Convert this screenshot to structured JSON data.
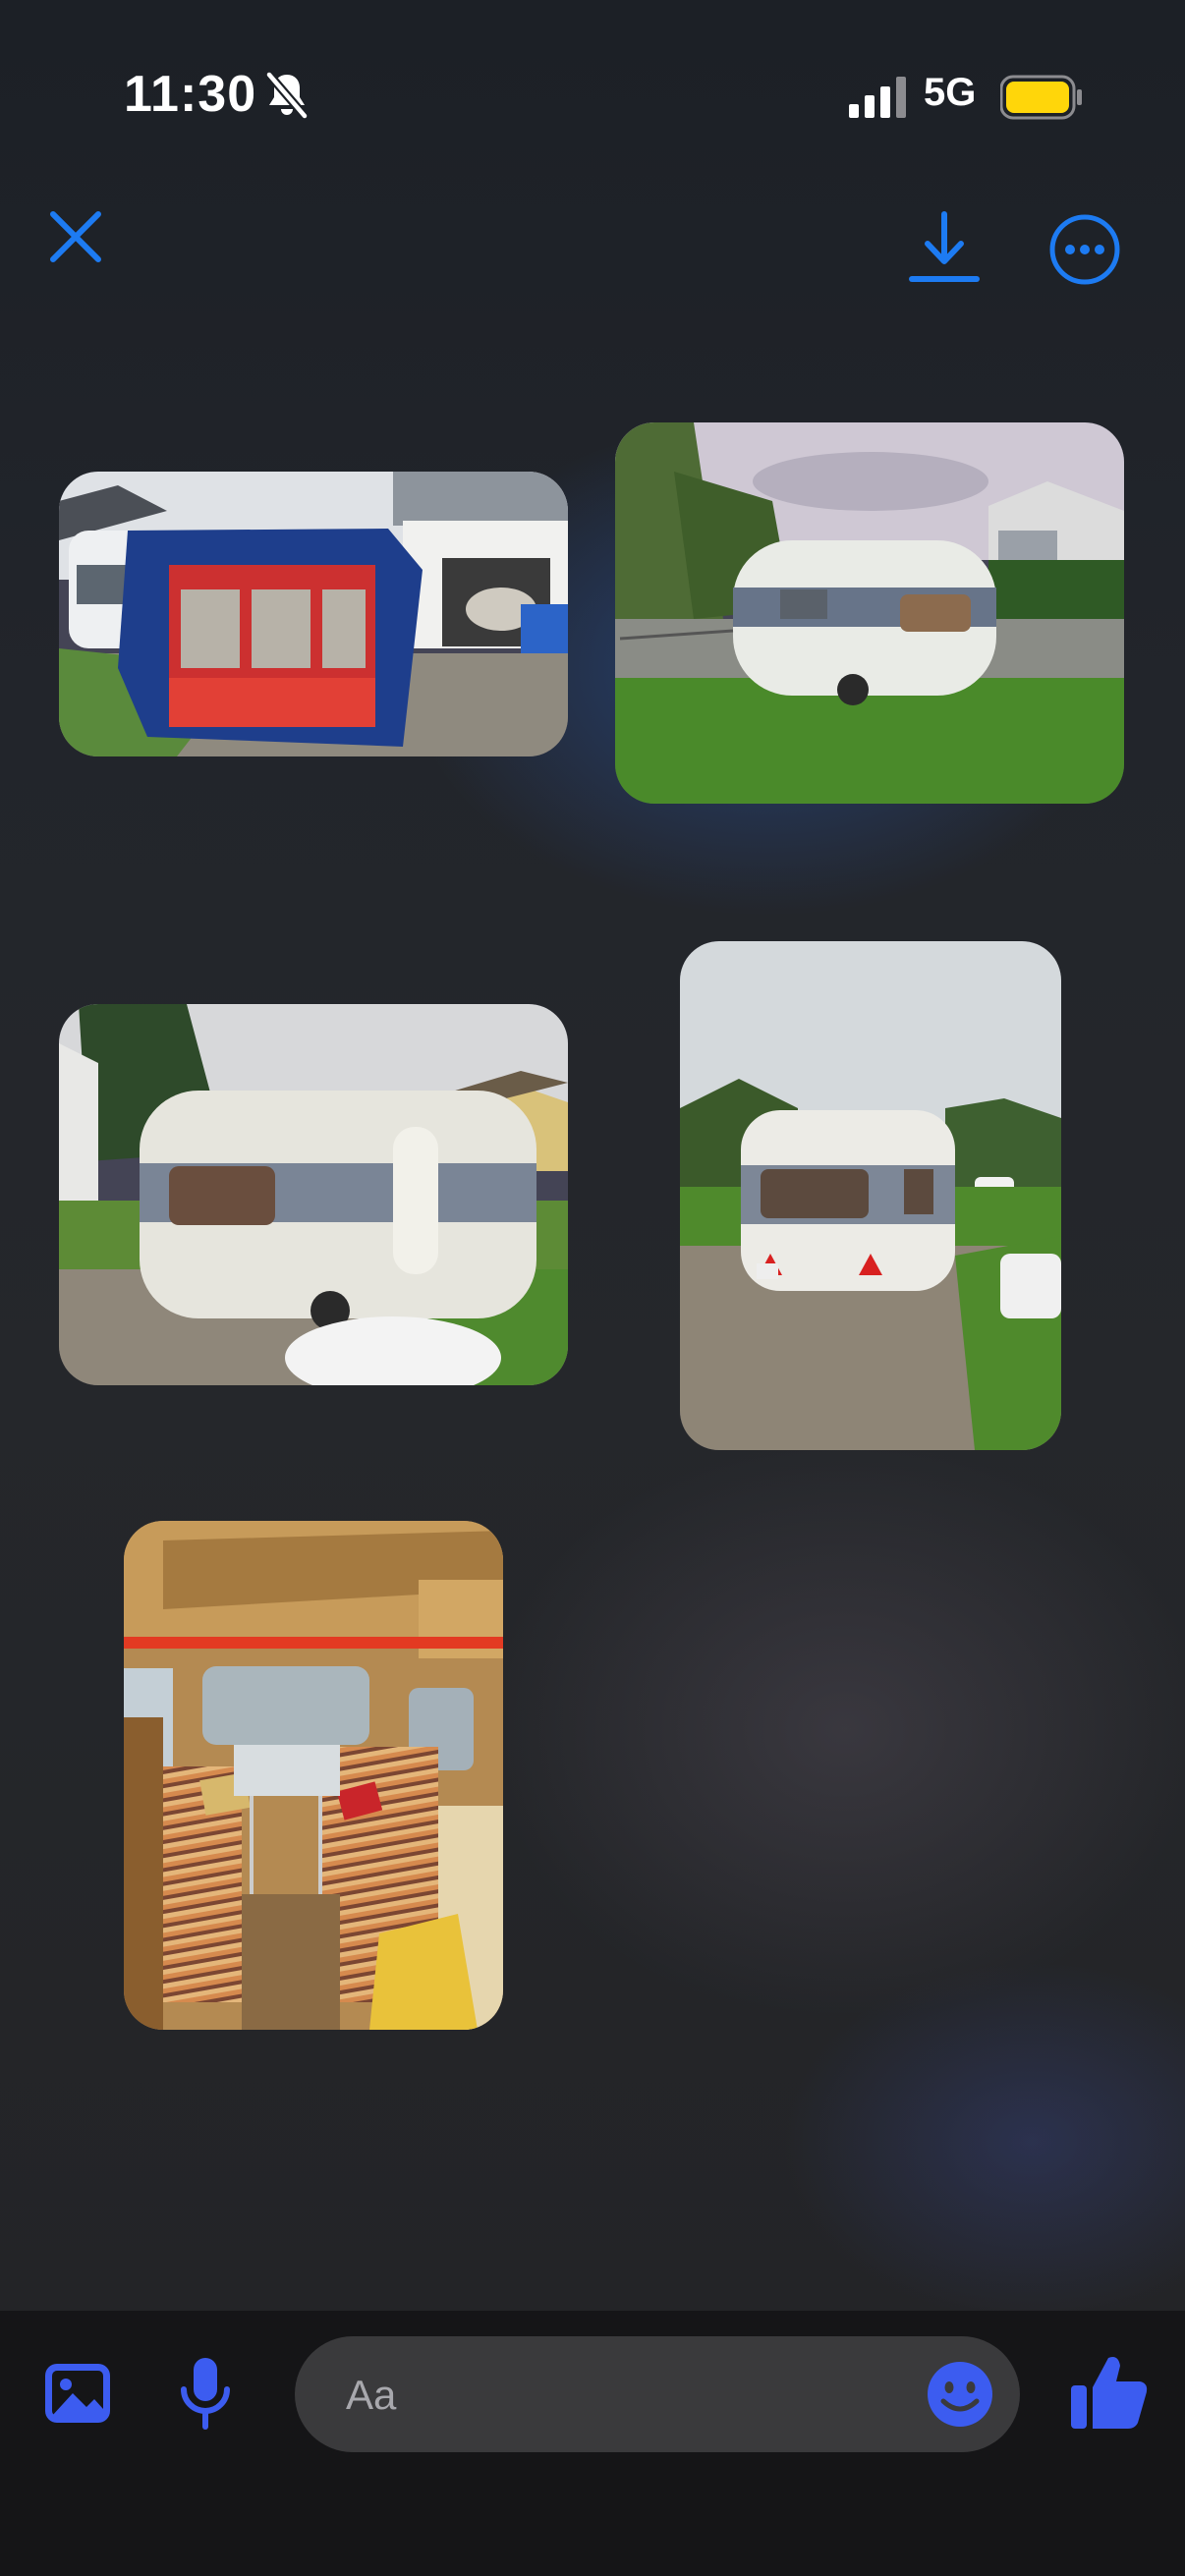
{
  "status_bar": {
    "time": "11:30",
    "network": "5G",
    "icons": [
      "bell-slash-icon",
      "signal-bars-icon",
      "battery-icon"
    ]
  },
  "toolbar": {
    "icons": [
      "close-icon",
      "download-icon",
      "more-options-icon"
    ]
  },
  "photos": [
    {
      "name": "caravan-with-awning-photo"
    },
    {
      "name": "caravan-side-photo"
    },
    {
      "name": "caravan-rear-photo"
    },
    {
      "name": "caravan-back-photo"
    },
    {
      "name": "caravan-interior-photo"
    }
  ],
  "composer": {
    "placeholder": "Aa",
    "icons": [
      "gallery-icon",
      "microphone-icon",
      "emoji-icon",
      "thumbs-up-icon"
    ]
  },
  "colors": {
    "accent": "#1d7bf2",
    "composer_icon": "#3c5cf0",
    "battery": "#ffd60a",
    "background": "#1f1f21",
    "input_background": "#3a3a3c"
  }
}
